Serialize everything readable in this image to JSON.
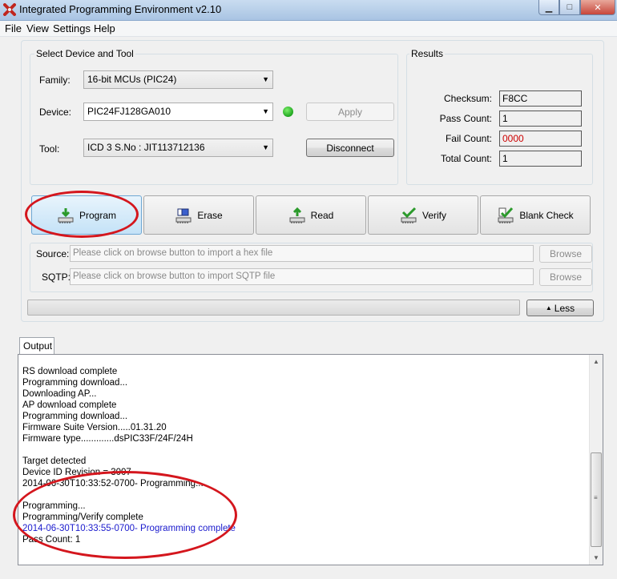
{
  "window": {
    "title": "Integrated Programming Environment v2.10",
    "minimize_label": "▁",
    "maximize_label": "□",
    "close_label": "✕"
  },
  "menu": [
    "File",
    "View",
    "Settings",
    "Help"
  ],
  "device_group": {
    "title": "Select Device and Tool",
    "family_label": "Family:",
    "family_value": "16-bit MCUs (PIC24)",
    "device_label": "Device:",
    "device_value": "PIC24FJ128GA010",
    "tool_label": "Tool:",
    "tool_value": "ICD 3 S.No : JIT113712136",
    "apply_label": "Apply",
    "disconnect_label": "Disconnect",
    "status_led_color": "#1fa51f"
  },
  "results": {
    "title": "Results",
    "checksum_label": "Checksum:",
    "checksum_value": "F8CC",
    "pass_label": "Pass Count:",
    "pass_value": "1",
    "fail_label": "Fail Count:",
    "fail_value": "0000",
    "fail_color": "#cc0000",
    "total_label": "Total Count:",
    "total_value": "1"
  },
  "actions": [
    {
      "label": "Program",
      "icon": "program-icon",
      "active": true
    },
    {
      "label": "Erase",
      "icon": "erase-icon",
      "active": false
    },
    {
      "label": "Read",
      "icon": "read-icon",
      "active": false
    },
    {
      "label": "Verify",
      "icon": "verify-icon",
      "active": false
    },
    {
      "label": "Blank Check",
      "icon": "blank-check-icon",
      "active": false
    }
  ],
  "source": {
    "label": "Source:",
    "placeholder": "Please click on browse button to import a hex file",
    "browse_label": "Browse"
  },
  "sqtp": {
    "label": "SQTP:",
    "placeholder": "Please click on browse button to import SQTP file",
    "browse_label": "Browse"
  },
  "less_label": "Less",
  "output": {
    "tab_label": "Output",
    "lines": [
      {
        "text": "",
        "color": "black"
      },
      {
        "text": "RS download complete",
        "color": "black"
      },
      {
        "text": "Programming download...",
        "color": "black"
      },
      {
        "text": "Downloading AP...",
        "color": "black"
      },
      {
        "text": "AP download complete",
        "color": "black"
      },
      {
        "text": "Programming download...",
        "color": "black"
      },
      {
        "text": "Firmware Suite Version.....01.31.20",
        "color": "black"
      },
      {
        "text": "Firmware type.............dsPIC33F/24F/24H",
        "color": "black"
      },
      {
        "text": "",
        "color": "black"
      },
      {
        "text": "Target detected",
        "color": "black"
      },
      {
        "text": "Device ID Revision = 3007",
        "color": "black"
      },
      {
        "text": "2014-06-30T10:33:52-0700- Programming...",
        "color": "black"
      },
      {
        "text": "",
        "color": "black"
      },
      {
        "text": "Programming...",
        "color": "black"
      },
      {
        "text": "Programming/Verify complete",
        "color": "black"
      },
      {
        "text": "2014-06-30T10:33:55-0700- Programming complete",
        "color": "blue"
      },
      {
        "text": "Pass Count: 1",
        "color": "black"
      }
    ]
  },
  "annotation_color": "#d4161d"
}
